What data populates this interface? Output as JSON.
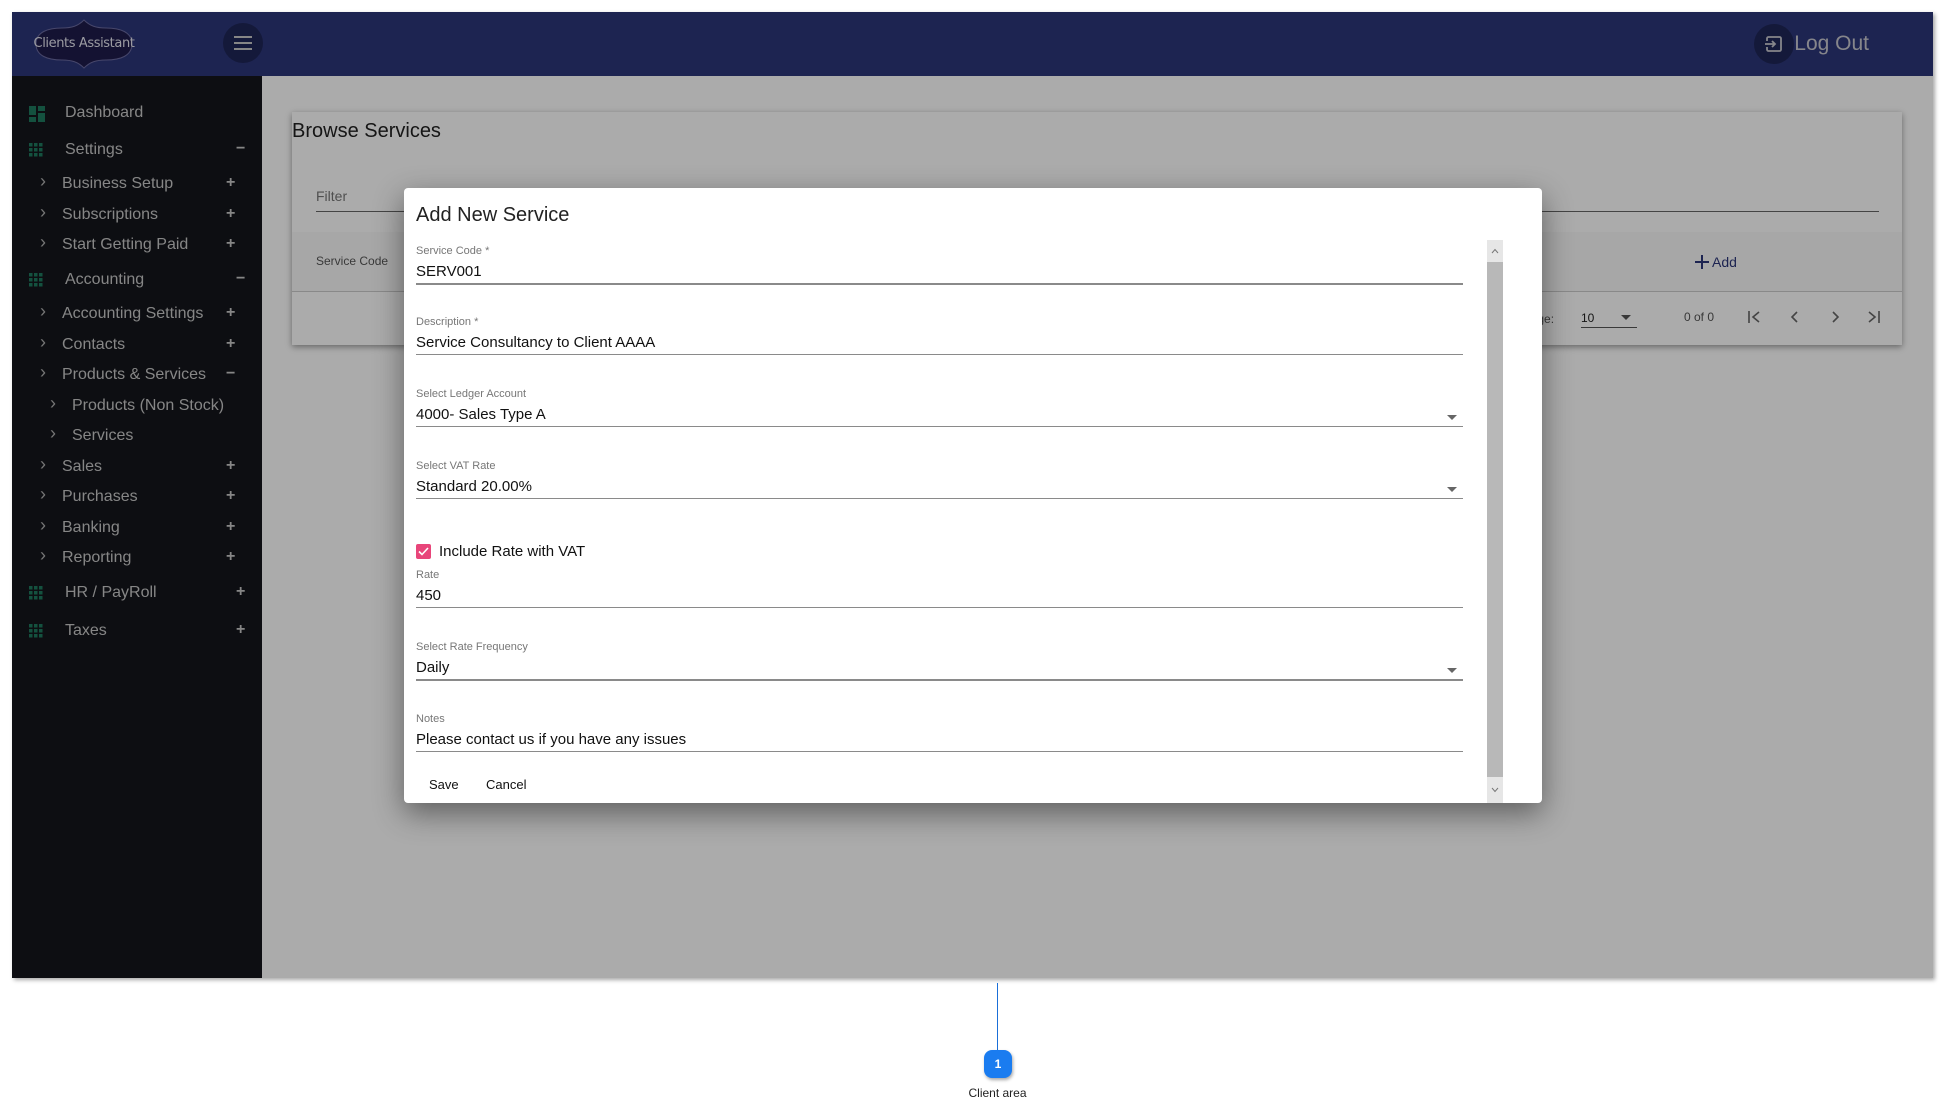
{
  "app": {
    "logo_text": "Clients Assistant",
    "logout_label": "Log Out"
  },
  "sidebar": {
    "items": [
      {
        "label": "Dashboard",
        "level": 0,
        "icon": "dashboard-icon",
        "toggle": ""
      },
      {
        "label": "Settings",
        "level": 0,
        "icon": "grid-icon",
        "toggle": "−"
      },
      {
        "label": "Business Setup",
        "level": 1,
        "toggle": "+"
      },
      {
        "label": "Subscriptions",
        "level": 1,
        "toggle": "+"
      },
      {
        "label": "Start Getting Paid",
        "level": 1,
        "toggle": "+"
      },
      {
        "label": "Accounting",
        "level": 0,
        "icon": "grid-icon",
        "toggle": "−"
      },
      {
        "label": "Accounting Settings",
        "level": 1,
        "toggle": "+"
      },
      {
        "label": "Contacts",
        "level": 1,
        "toggle": "+"
      },
      {
        "label": "Products & Services",
        "level": 1,
        "toggle": "−"
      },
      {
        "label": "Products (Non Stock)",
        "level": 2,
        "toggle": ""
      },
      {
        "label": "Services",
        "level": 2,
        "toggle": ""
      },
      {
        "label": "Sales",
        "level": 1,
        "toggle": "+"
      },
      {
        "label": "Purchases",
        "level": 1,
        "toggle": "+"
      },
      {
        "label": "Banking",
        "level": 1,
        "toggle": "+"
      },
      {
        "label": "Reporting",
        "level": 1,
        "toggle": "+"
      },
      {
        "label": "HR / PayRoll",
        "level": 0,
        "icon": "grid-icon",
        "toggle": "+"
      },
      {
        "label": "Taxes",
        "level": 0,
        "icon": "grid-icon",
        "toggle": "+"
      }
    ]
  },
  "browse": {
    "title": "Browse Services",
    "filter_placeholder": "Filter",
    "column_service_code": "Service Code",
    "add_label": "Add",
    "rows_per_page_label": "Rows per page:",
    "rows_per_page_value": "10",
    "range_text": "0 of 0"
  },
  "dialog": {
    "title": "Add New Service",
    "fields": {
      "service_code": {
        "label": "Service Code *",
        "value": "SERV001"
      },
      "description": {
        "label": "Description *",
        "value": "Service Consultancy to Client AAAA"
      },
      "ledger_account": {
        "label": "Select Ledger Account",
        "value": "4000- Sales Type A"
      },
      "vat_rate": {
        "label": "Select VAT Rate",
        "value": "Standard 20.00%"
      },
      "include_vat": {
        "label": "Include Rate with VAT",
        "checked": true
      },
      "rate": {
        "label": "Rate",
        "value": "450"
      },
      "rate_frequency": {
        "label": "Select Rate Frequency",
        "value": "Daily"
      },
      "notes": {
        "label": "Notes",
        "value": "Please contact us if you have any issues"
      }
    },
    "save_label": "Save",
    "cancel_label": "Cancel"
  },
  "annotation": {
    "number": "1",
    "label": "Client area"
  },
  "colors": {
    "header_bg": "#2c3679",
    "sidebar_bg": "#14161c",
    "sidebar_icon": "#1e7a5e",
    "checkbox_accent": "#e8457a",
    "annotation_blue": "#1a7cf0"
  }
}
